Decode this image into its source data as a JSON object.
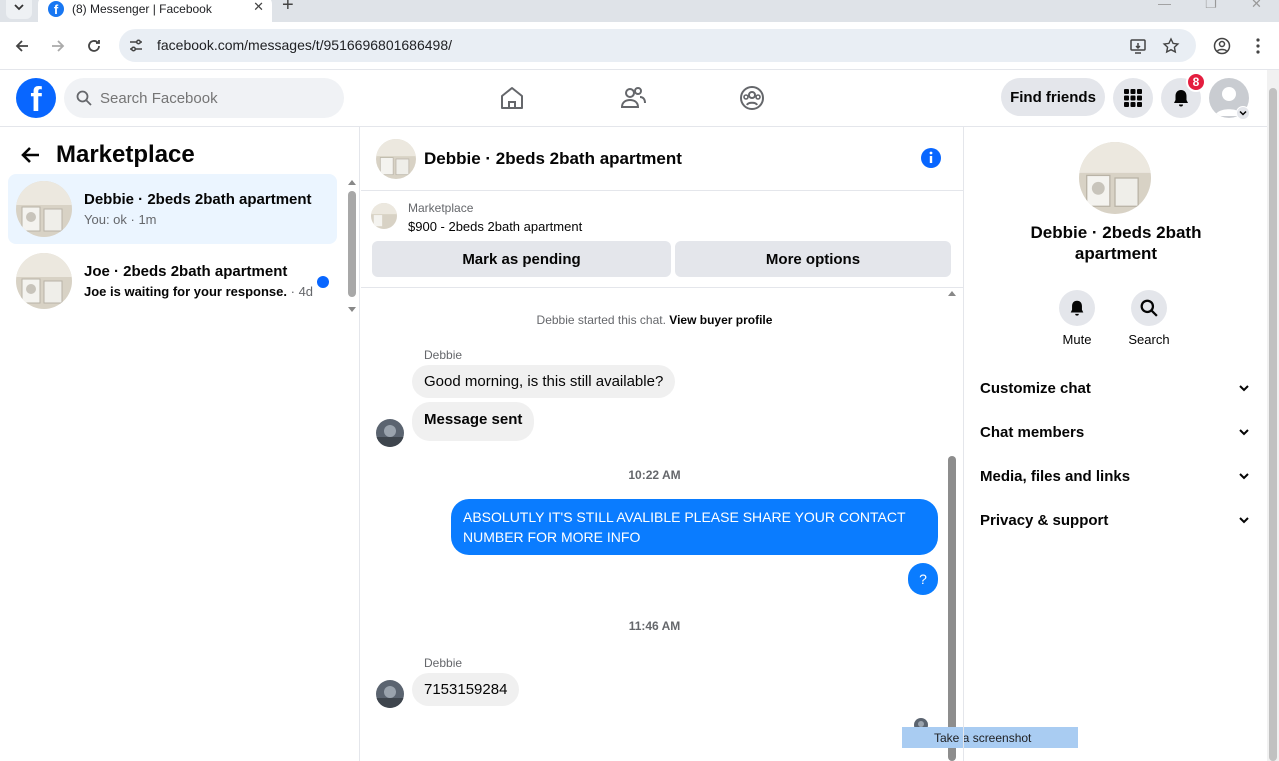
{
  "browser": {
    "tab_title": "(8) Messenger | Facebook",
    "url": "facebook.com/messages/t/9516696801686498/",
    "favicon_letter": "f"
  },
  "fbnav": {
    "logo_letter": "f",
    "search_placeholder": "Search Facebook",
    "find_friends_label": "Find friends",
    "notification_count": "8",
    "brand_color": "#0866ff"
  },
  "left": {
    "title": "Marketplace",
    "conversations": [
      {
        "name": "Debbie · 2beds 2bath apartment",
        "preview": "You: ok · 1m",
        "active": true,
        "unread": false
      },
      {
        "name": "Joe · 2beds 2bath apartment",
        "preview": "Joe is waiting for your response.",
        "time": "· 4d",
        "active": false,
        "unread": true
      }
    ]
  },
  "chat": {
    "title": "Debbie · 2beds 2bath apartment",
    "listing": {
      "label": "Marketplace",
      "price_title": "$900 - 2beds 2bath apartment",
      "mark_pending_label": "Mark as pending",
      "more_options_label": "More options"
    },
    "system_message": "Debbie started this chat.",
    "system_link": "View buyer profile",
    "messages": [
      {
        "sender": "Debbie",
        "text": "Good morning, is this still available?"
      },
      {
        "text": "Message sent"
      },
      {
        "time": "10:22 AM"
      },
      {
        "outgoing": true,
        "text": "ABSOLUTLY IT'S STILL AVALIBLE PLEASE SHARE YOUR CONTACT NUMBER  FOR MORE INFO"
      },
      {
        "outgoing": true,
        "text": "?"
      },
      {
        "time": "11:46 AM"
      },
      {
        "sender": "Debbie",
        "text": "7153159284"
      }
    ],
    "outgoing_color": "#0a7cff",
    "tooltip": "Take a screenshot"
  },
  "right": {
    "name": "Debbie · 2beds 2bath apartment",
    "actions": [
      {
        "label": "Mute",
        "icon": "bell-icon"
      },
      {
        "label": "Search",
        "icon": "search-icon"
      }
    ],
    "sections": [
      {
        "label": "Customize chat"
      },
      {
        "label": "Chat members"
      },
      {
        "label": "Media, files and links"
      },
      {
        "label": "Privacy & support"
      }
    ]
  }
}
